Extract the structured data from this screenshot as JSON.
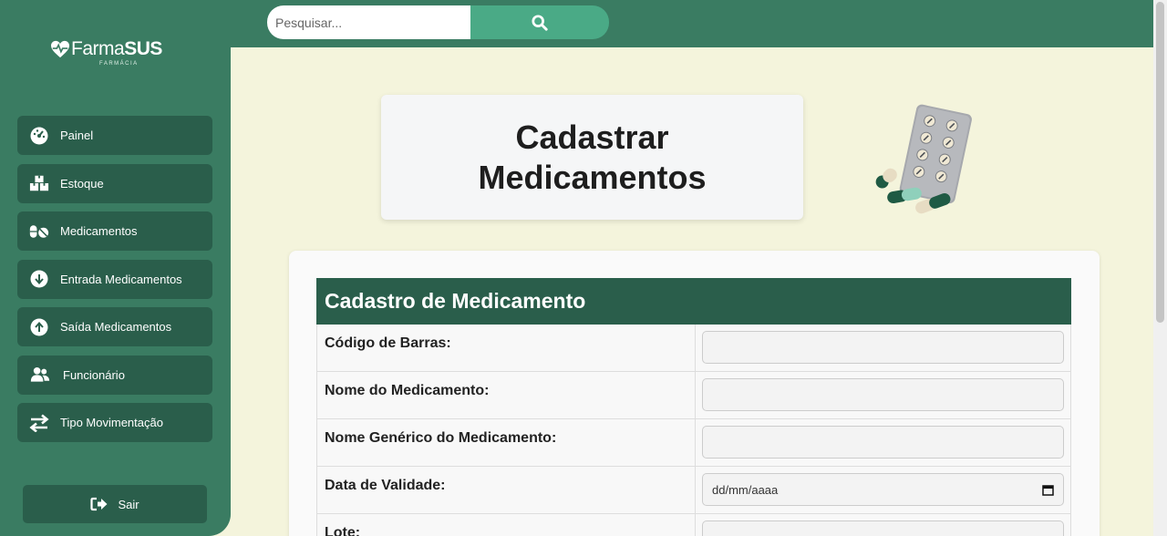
{
  "search": {
    "placeholder": "Pesquisar..."
  },
  "logo": {
    "brand_light": "Farma",
    "brand_bold": "SUS",
    "sub": "FARMÁCIA"
  },
  "sidebar": {
    "items": [
      {
        "label": "Painel",
        "icon": "dashboard-icon"
      },
      {
        "label": "Estoque",
        "icon": "boxes-icon"
      },
      {
        "label": "Medicamentos",
        "icon": "pills-icon"
      },
      {
        "label": "Entrada Medicamentos",
        "icon": "arrow-down-circle-icon"
      },
      {
        "label": "Saída Medicamentos",
        "icon": "arrow-up-circle-icon"
      },
      {
        "label": "Funcionário",
        "icon": "users-icon"
      },
      {
        "label": "Tipo Movimentação",
        "icon": "swap-arrows-icon"
      }
    ],
    "logout": "Sair"
  },
  "page": {
    "title": "Cadastrar Medicamentos"
  },
  "form": {
    "heading": "Cadastro de Medicamento",
    "rows": [
      {
        "label": "Código de Barras:",
        "value": ""
      },
      {
        "label": "Nome do Medicamento:",
        "value": ""
      },
      {
        "label": "Nome Genérico do Medicamento:",
        "value": ""
      },
      {
        "label": "Data de Validade:",
        "value": "dd/mm/aaaa"
      },
      {
        "label": "Lote:",
        "value": ""
      }
    ]
  },
  "colors": {
    "primary": "#3a7c62",
    "dark": "#2a5e4b",
    "accent": "#4aaa86",
    "background": "#f4f4dc"
  }
}
